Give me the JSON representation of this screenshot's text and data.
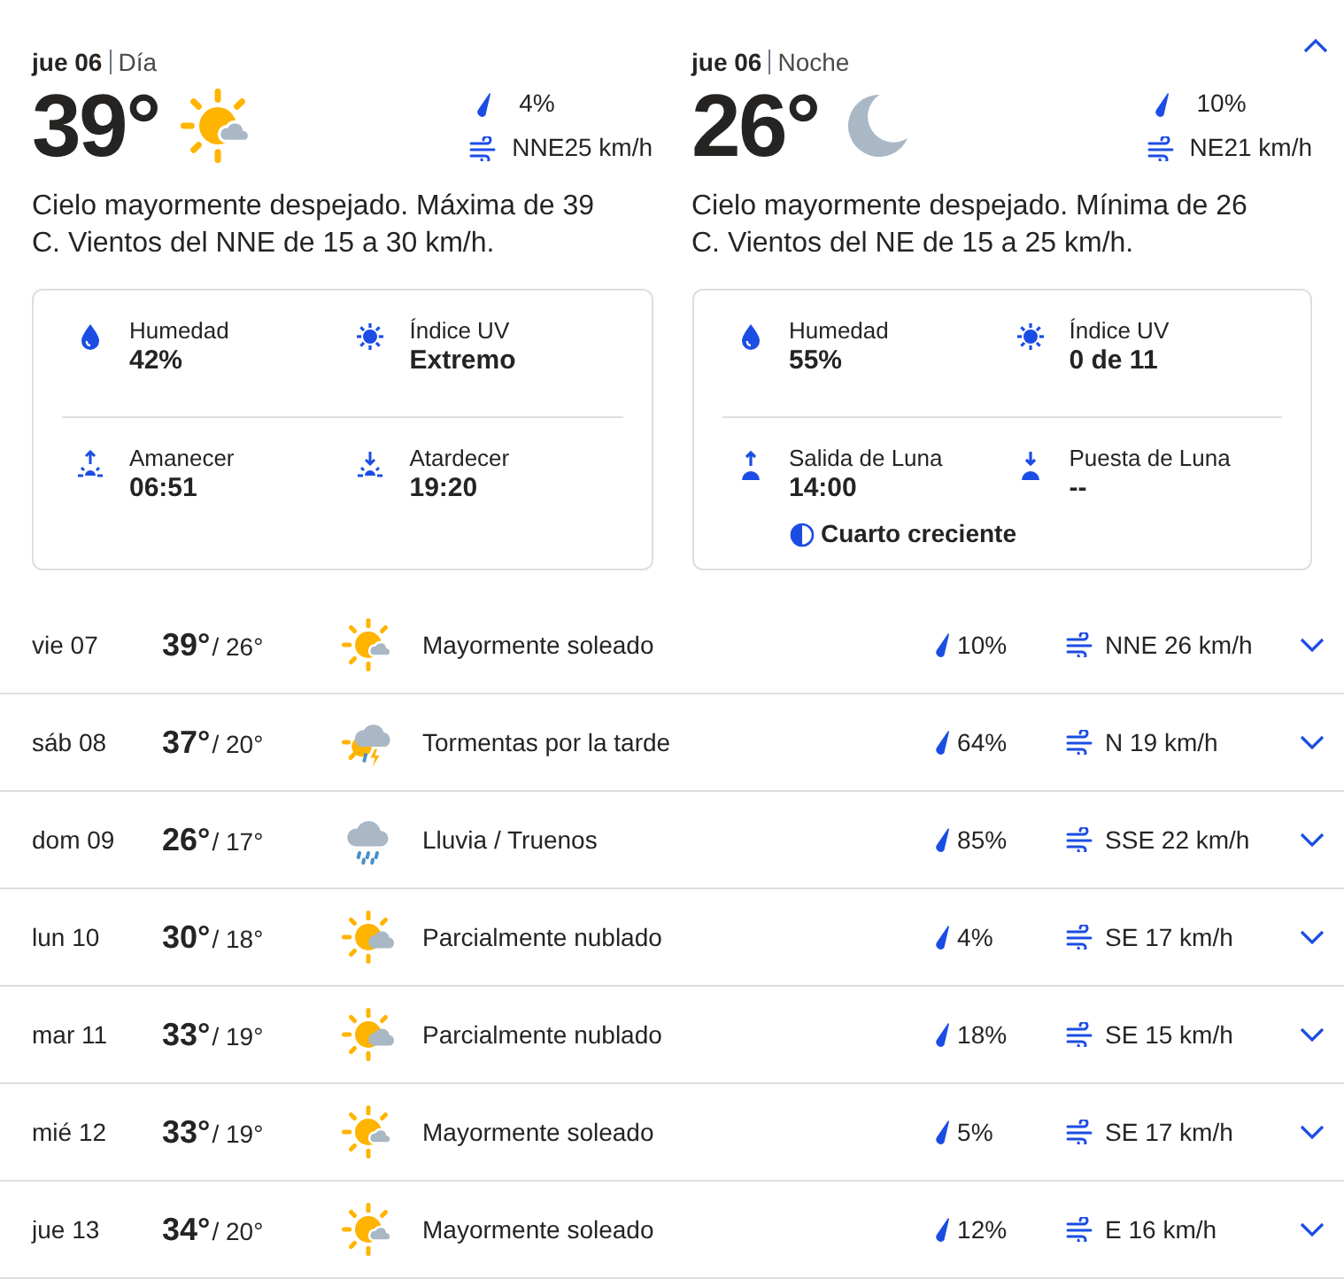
{
  "collapse_button": {
    "expanded": true
  },
  "periods": [
    {
      "date": "jue 06",
      "part": "Día",
      "temp": "39°",
      "kind": "mostly_sunny",
      "precip": "4%",
      "wind": "NNE25 km/h",
      "description": "Cielo mayormente despejado. Máxima de 39 C. Vientos del NNE de 15 a 30 km/h.",
      "details": [
        {
          "kind": "humidity",
          "label": "Humedad",
          "value": "42%"
        },
        {
          "kind": "uv",
          "label": "Índice UV",
          "value": "Extremo"
        },
        {
          "kind": "sunrise",
          "label": "Amanecer",
          "value": "06:51"
        },
        {
          "kind": "sunset",
          "label": "Atardecer",
          "value": "19:20"
        }
      ]
    },
    {
      "date": "jue 06",
      "part": "Noche",
      "temp": "26°",
      "kind": "moon",
      "precip": "10%",
      "wind": "NE21 km/h",
      "description": "Cielo mayormente despejado. Mínima de 26 C. Vientos del NE de 15 a 25 km/h.",
      "details": [
        {
          "kind": "humidity",
          "label": "Humedad",
          "value": "55%"
        },
        {
          "kind": "uv",
          "label": "Índice UV",
          "value": "0 de 11"
        },
        {
          "kind": "moonrise",
          "label": "Salida de Luna",
          "value": "14:00"
        },
        {
          "kind": "moonset",
          "label": "Puesta de Luna",
          "value": "--"
        }
      ],
      "moon_phase": "Cuarto creciente"
    }
  ],
  "days": [
    {
      "day": "vie 07",
      "high": "39°",
      "low": "/ 26°",
      "kind": "mostly_sunny",
      "condition": "Mayormente soleado",
      "precip": "10%",
      "wind": "NNE 26 km/h",
      "expanded": false
    },
    {
      "day": "sáb 08",
      "high": "37°",
      "low": "/ 20°",
      "kind": "storms",
      "condition": "Tormentas por la tarde",
      "precip": "64%",
      "wind": "N 19 km/h",
      "expanded": false
    },
    {
      "day": "dom 09",
      "high": "26°",
      "low": "/ 17°",
      "kind": "rain",
      "condition": "Lluvia / Truenos",
      "precip": "85%",
      "wind": "SSE 22 km/h",
      "expanded": false
    },
    {
      "day": "lun 10",
      "high": "30°",
      "low": "/ 18°",
      "kind": "partly_cloudy",
      "condition": "Parcialmente nublado",
      "precip": "4%",
      "wind": "SE 17 km/h",
      "expanded": false
    },
    {
      "day": "mar 11",
      "high": "33°",
      "low": "/ 19°",
      "kind": "partly_cloudy",
      "condition": "Parcialmente nublado",
      "precip": "18%",
      "wind": "SE 15 km/h",
      "expanded": false
    },
    {
      "day": "mié 12",
      "high": "33°",
      "low": "/ 19°",
      "kind": "mostly_sunny",
      "condition": "Mayormente soleado",
      "precip": "5%",
      "wind": "SE 17 km/h",
      "expanded": false
    },
    {
      "day": "jue 13",
      "high": "34°",
      "low": "/ 20°",
      "kind": "mostly_sunny",
      "condition": "Mayormente soleado",
      "precip": "12%",
      "wind": "E 16 km/h",
      "expanded": false
    }
  ]
}
